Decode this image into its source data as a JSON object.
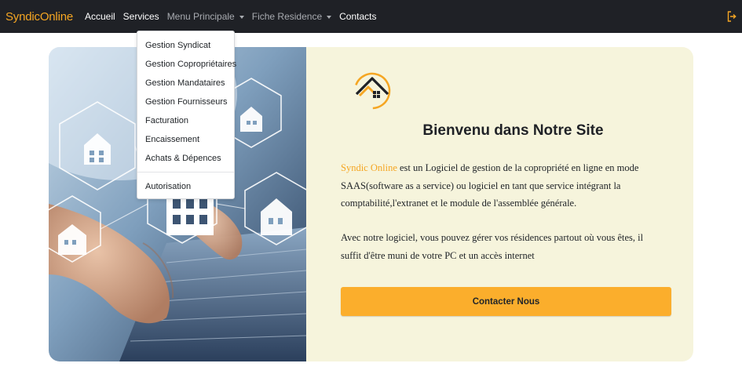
{
  "navbar": {
    "brand": "SyndicOnline",
    "items": [
      {
        "label": "Accueil",
        "has_caret": false
      },
      {
        "label": "Services",
        "has_caret": false
      },
      {
        "label": "Menu Principale",
        "has_caret": true
      },
      {
        "label": "Fiche Residence",
        "has_caret": true
      },
      {
        "label": "Contacts",
        "has_caret": false
      }
    ],
    "logout_icon": "sign-out-icon"
  },
  "dropdown": {
    "items": [
      "Gestion Syndicat",
      "Gestion Copropriétaires",
      "Gestion Mandataires",
      "Gestion Fournisseurs",
      "Facturation",
      "Encaissement",
      "Achats & Dépences"
    ],
    "footer_item": "Autorisation"
  },
  "hero": {
    "title": "Bienvenu dans Notre Site",
    "paragraph1": {
      "highlight": "Syndic Online",
      "text": " est un Logiciel de gestion de la copropriété en ligne en mode SAAS(software as a service) ou logiciel en tant que service intégrant la comptabilité,l'extranet et le module de l'assemblée générale."
    },
    "paragraph2": "Avec notre logiciel, vous pouvez gérer vos résidences partout où vous êtes, il suffit d'être muni de votre PC et un accès internet",
    "cta_label": "Contacter Nous"
  },
  "colors": {
    "navbar_bg": "#1f2126",
    "brand": "#f5a623",
    "card_bg": "#f6f4dc",
    "cta_bg": "#fbae2c"
  }
}
